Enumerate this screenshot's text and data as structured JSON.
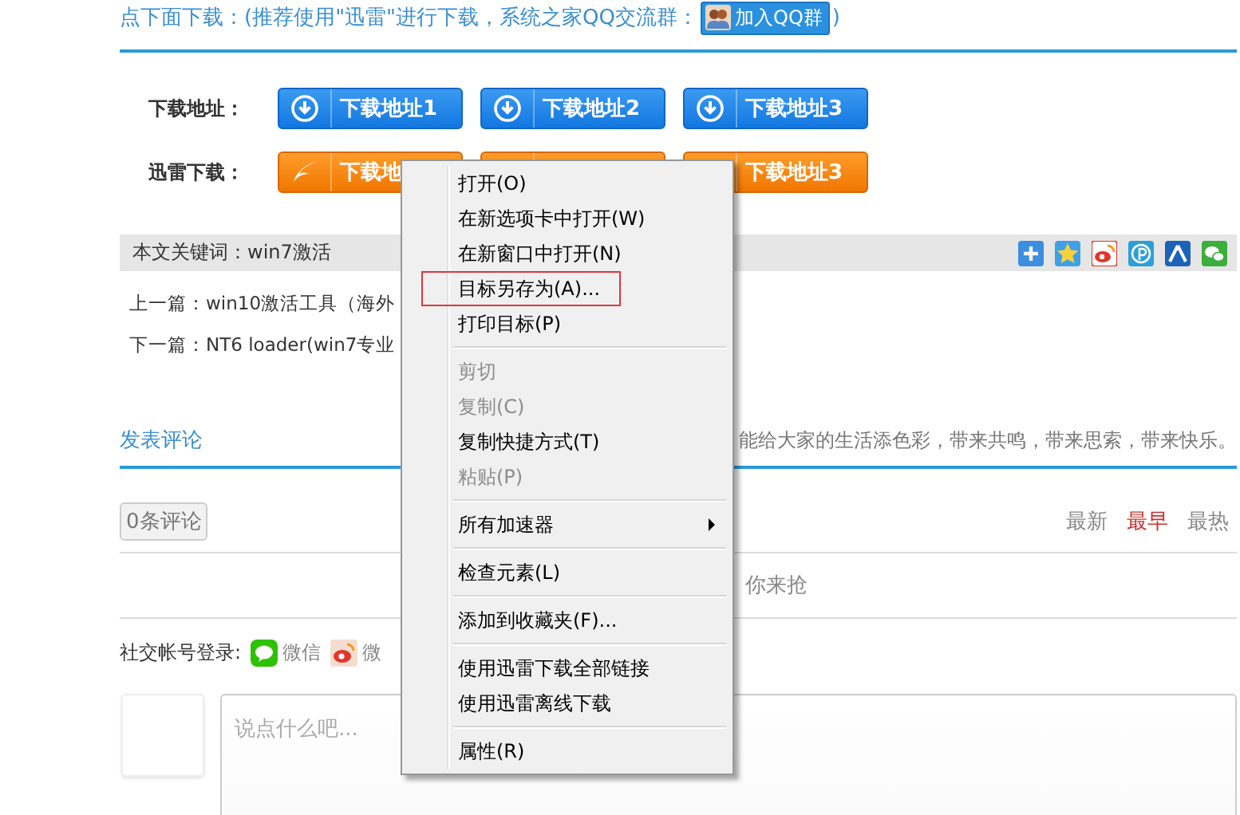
{
  "header": {
    "text": "点下面下载：(推荐使用\"迅雷\"进行下载，系统之家QQ交流群：",
    "qq_button": "加入QQ群",
    "closing": ")"
  },
  "download_rows": [
    {
      "label": "下载地址：",
      "kind": "direct",
      "buttons": [
        {
          "label": "下载地址1"
        },
        {
          "label": "下载地址2"
        },
        {
          "label": "下载地址3"
        }
      ]
    },
    {
      "label": "迅雷下载：",
      "kind": "thunder",
      "buttons": [
        {
          "label": "下载地"
        },
        {
          "covered": true
        },
        {
          "label": "下载地址3"
        }
      ]
    }
  ],
  "keywords": "本文关键词：win7激活",
  "prev": "上一篇：win10激活工具（海外",
  "next": "下一篇：NT6 loader(win7专业",
  "comment_tab": "发表评论",
  "slogan": "能给大家的生活添色彩，带来共鸣，带来思索，带来快乐。",
  "comment_count": "0条评论",
  "sort": [
    {
      "label": "最新",
      "selected": false
    },
    {
      "label": "最早",
      "selected": true
    },
    {
      "label": "最热",
      "selected": false
    }
  ],
  "empty_text": "你来抢",
  "social_login": {
    "label": "社交帐号登录:",
    "providers": [
      {
        "kind": "wechat",
        "label": "微信"
      },
      {
        "kind": "weibo",
        "label": "微"
      }
    ]
  },
  "comment_box": {
    "placeholder": "说点什么吧..."
  },
  "context_menu": [
    {
      "kind": "item",
      "label": "打开(O)",
      "disabled": false,
      "highlighted": false
    },
    {
      "kind": "item",
      "label": "在新选项卡中打开(W)",
      "disabled": false,
      "highlighted": false
    },
    {
      "kind": "item",
      "label": "在新窗口中打开(N)",
      "disabled": false,
      "highlighted": false
    },
    {
      "kind": "item",
      "label": "目标另存为(A)...",
      "disabled": false,
      "highlighted": true
    },
    {
      "kind": "item",
      "label": "打印目标(P)",
      "disabled": false,
      "highlighted": false
    },
    {
      "kind": "separator"
    },
    {
      "kind": "item",
      "label": "剪切",
      "disabled": true,
      "highlighted": false
    },
    {
      "kind": "item",
      "label": "复制(C)",
      "disabled": true,
      "highlighted": false
    },
    {
      "kind": "item",
      "label": "复制快捷方式(T)",
      "disabled": false,
      "highlighted": false
    },
    {
      "kind": "item",
      "label": "粘贴(P)",
      "disabled": true,
      "highlighted": false
    },
    {
      "kind": "separator"
    },
    {
      "kind": "submenu",
      "label": "所有加速器",
      "disabled": false,
      "highlighted": false
    },
    {
      "kind": "separator"
    },
    {
      "kind": "item",
      "label": "检查元素(L)",
      "disabled": false,
      "highlighted": false
    },
    {
      "kind": "separator"
    },
    {
      "kind": "item",
      "label": "添加到收藏夹(F)...",
      "disabled": false,
      "highlighted": false
    },
    {
      "kind": "separator"
    },
    {
      "kind": "item",
      "label": "使用迅雷下载全部链接",
      "disabled": false,
      "highlighted": false
    },
    {
      "kind": "item",
      "label": "使用迅雷离线下载",
      "disabled": false,
      "highlighted": false
    },
    {
      "kind": "separator"
    },
    {
      "kind": "item",
      "label": "属性(R)",
      "disabled": false,
      "highlighted": false
    }
  ]
}
